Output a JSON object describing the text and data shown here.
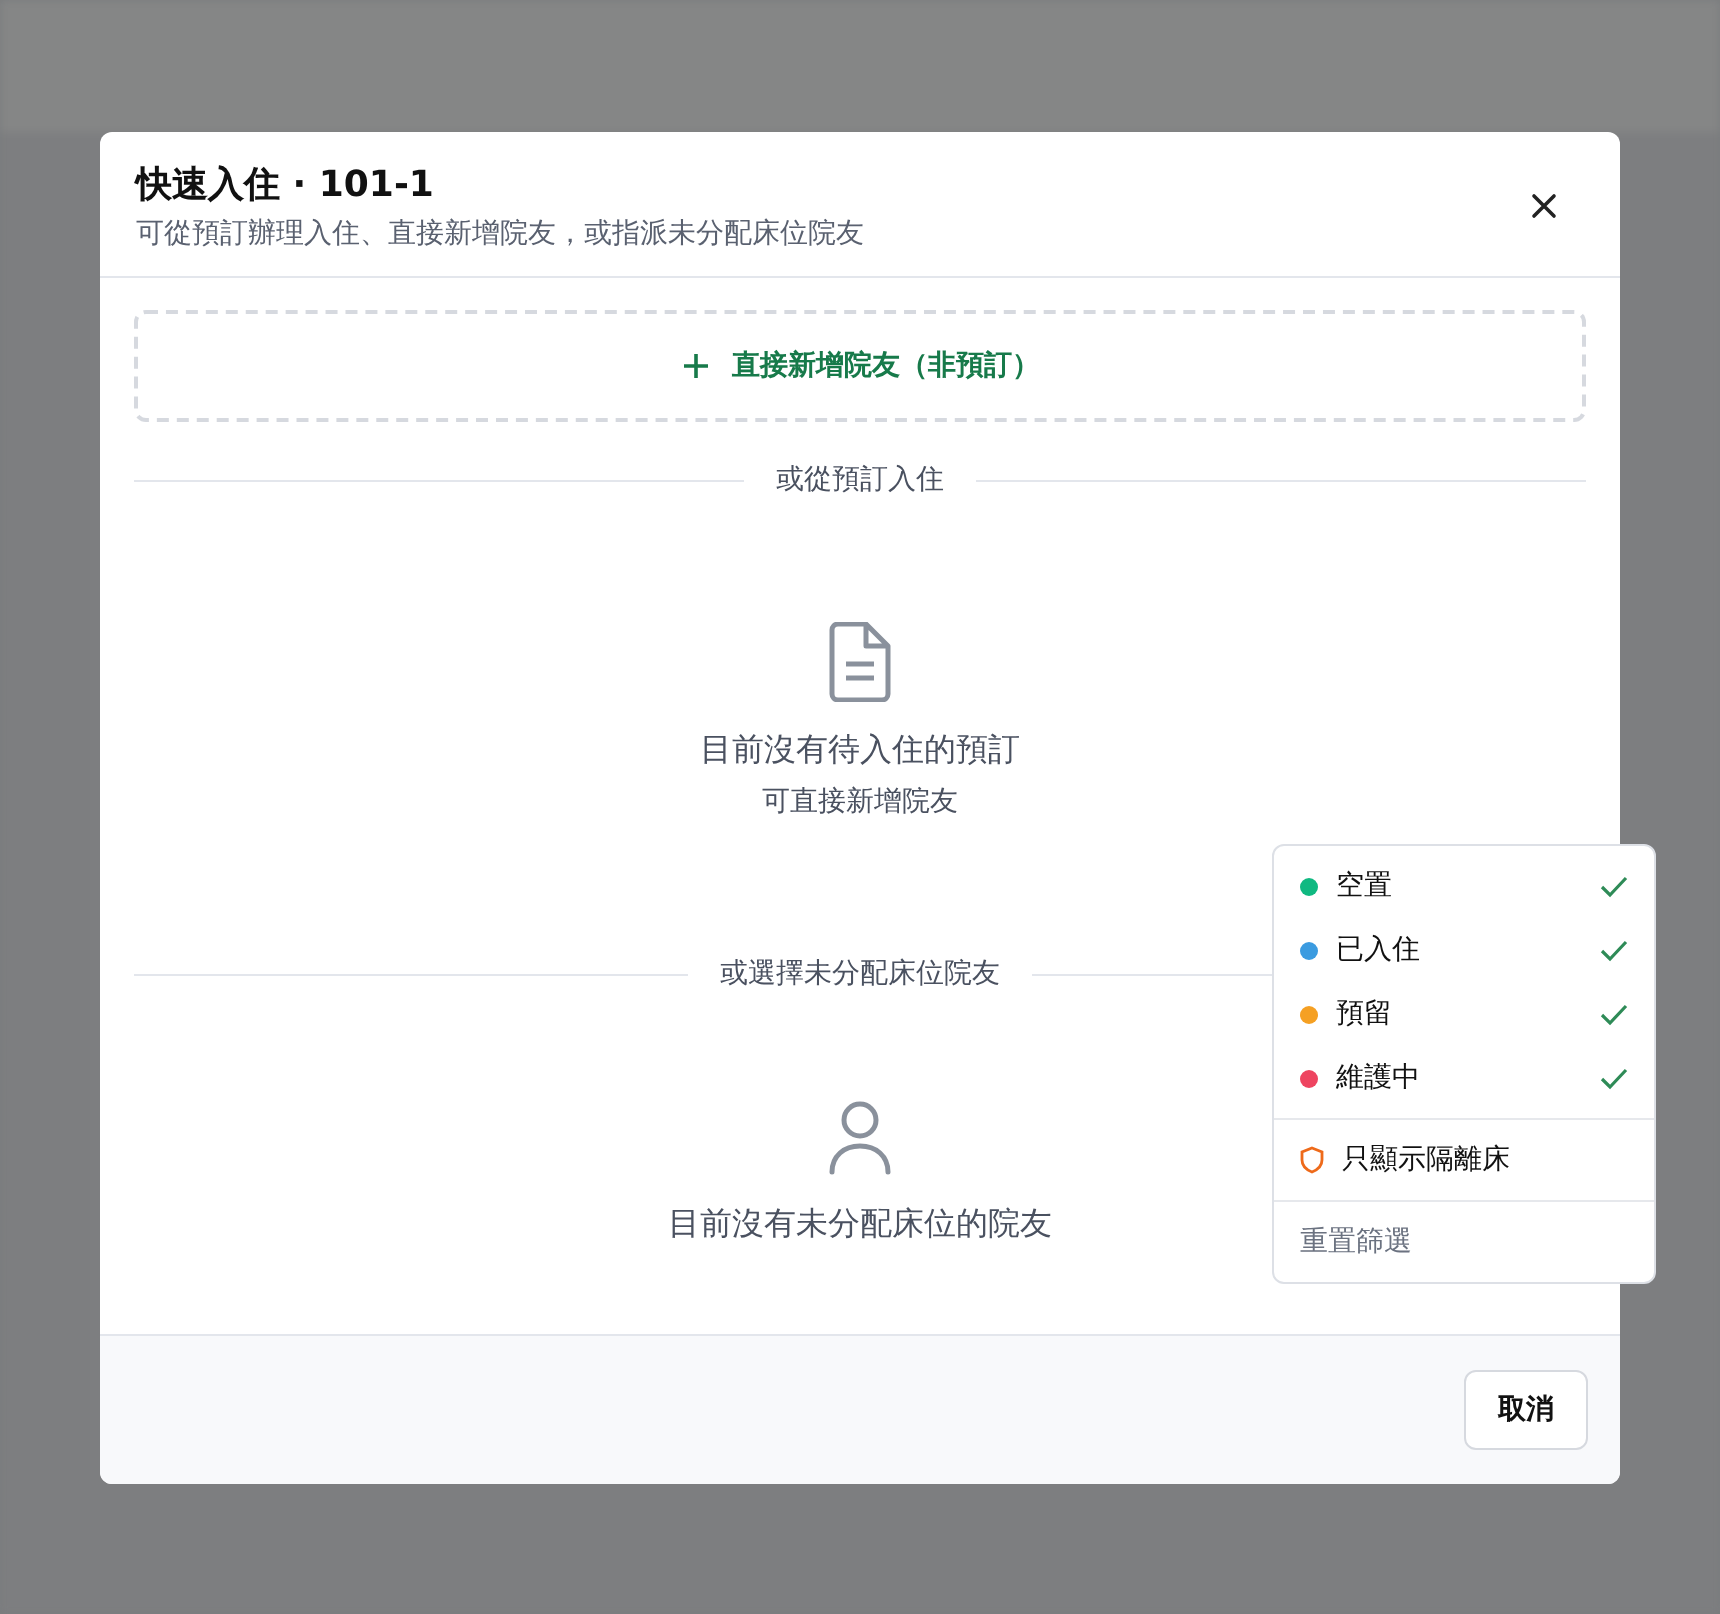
{
  "dialog": {
    "title": "快速入住 · 101-1",
    "subtitle": "可從預訂辦理入住、直接新增院友，或指派未分配床位院友",
    "add_button": "直接新增院友（非預訂）",
    "reservation_section": {
      "divider": "或從預訂入住",
      "empty_title": "目前沒有待入住的預訂",
      "empty_hint": "可直接新增院友"
    },
    "unassigned_section": {
      "divider": "或選擇未分配床位院友",
      "empty_title": "目前沒有未分配床位的院友"
    },
    "cancel_button": "取消"
  },
  "filter_menu": {
    "statuses": [
      {
        "label": "空置",
        "color": "#10b981",
        "checked": true
      },
      {
        "label": "已入住",
        "color": "#3b9be0",
        "checked": true
      },
      {
        "label": "預留",
        "color": "#f5a023",
        "checked": true
      },
      {
        "label": "維護中",
        "color": "#ee4460",
        "checked": true
      }
    ],
    "isolation": {
      "label": "只顯示隔離床",
      "checked": false
    },
    "reset": "重置篩選"
  }
}
